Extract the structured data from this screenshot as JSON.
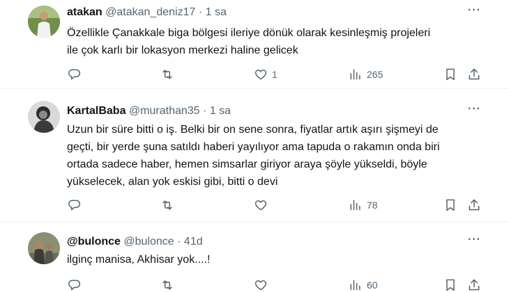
{
  "tweets": [
    {
      "name": "atakan",
      "handle": "@atakan_deniz17",
      "dot": "·",
      "time": "1 sa",
      "more": "···",
      "text_lines": [
        "Özellikle Çanakkale biga bölgesi ileriye dönük olarak kesinleşmiş projeleri",
        "ile çok karlı bir lokasyon merkezi haline gelicek"
      ],
      "likes": "1",
      "views": "265"
    },
    {
      "name": "KartalBaba",
      "handle": "@murathan35",
      "dot": "·",
      "time": "1 sa",
      "more": "···",
      "text_lines": [
        "Uzun bir süre bitti o iş. Belki bir on sene sonra, fiyatlar artık aşırı şişmeyi de",
        "geçti, bir yerde şuna satıldı haberi yayılıyor ama tapuda o rakamın onda biri",
        "ortada sadece haber, hemen simsarlar giriyor araya şöyle yükseldi, böyle",
        "yükselecek, alan yok eskisi gibi, bitti o devi"
      ],
      "likes": "",
      "views": "78"
    },
    {
      "name": "@bulonce",
      "handle": "@bulonce",
      "dot": "·",
      "time": "41d",
      "more": "···",
      "text_lines": [
        "ilginç manisa, Akhisar yok....!"
      ],
      "likes": "",
      "views": "60"
    }
  ],
  "icons": {
    "reply": "reply-icon",
    "retweet": "retweet-icon",
    "like": "heart-icon",
    "views": "views-chart-icon",
    "bookmark": "bookmark-icon",
    "share": "share-icon"
  }
}
